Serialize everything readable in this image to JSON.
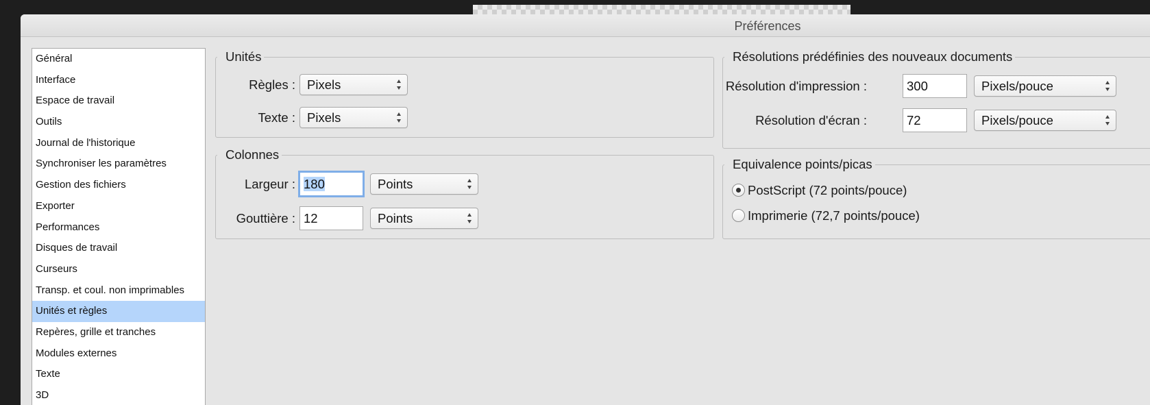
{
  "window": {
    "title": "Préférences"
  },
  "sidebar": {
    "items": [
      "Général",
      "Interface",
      "Espace de travail",
      "Outils",
      "Journal de l'historique",
      "Synchroniser les paramètres",
      "Gestion des fichiers",
      "Exporter",
      "Performances",
      "Disques de travail",
      "Curseurs",
      "Transp. et coul. non imprimables",
      "Unités et règles",
      "Repères, grille et tranches",
      "Modules externes",
      "Texte",
      "3D"
    ],
    "selected": "Unités et règles"
  },
  "units": {
    "legend": "Unités",
    "rules_label": "Règles :",
    "rules_value": "Pixels",
    "text_label": "Texte :",
    "text_value": "Pixels"
  },
  "columns": {
    "legend": "Colonnes",
    "width_label": "Largeur :",
    "width_value": "180",
    "width_unit": "Points",
    "gutter_label": "Gouttière :",
    "gutter_value": "12",
    "gutter_unit": "Points"
  },
  "resolutions": {
    "legend": "Résolutions prédéfinies des nouveaux documents",
    "print_label": "Résolution d'impression :",
    "print_value": "300",
    "print_unit": "Pixels/pouce",
    "screen_label": "Résolution d'écran :",
    "screen_value": "72",
    "screen_unit": "Pixels/pouce"
  },
  "points": {
    "legend": "Equivalence points/picas",
    "options": [
      {
        "label": "PostScript (72 points/pouce)",
        "selected": true
      },
      {
        "label": "Imprimerie (72,7 points/pouce)",
        "selected": false
      }
    ]
  }
}
